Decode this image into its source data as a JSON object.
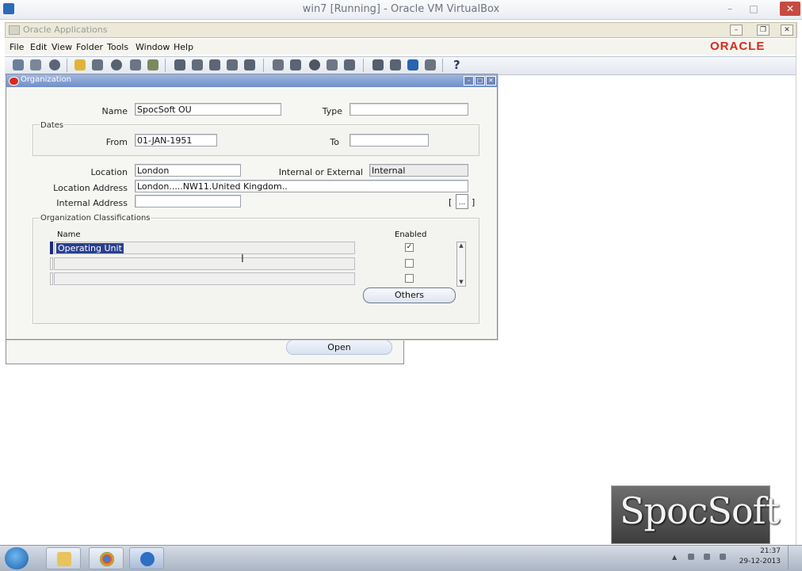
{
  "host": {
    "title": "win7 [Running] - Oracle VM VirtualBox",
    "buttons": {
      "minimize": "–",
      "maximize": "□",
      "close": "✕"
    }
  },
  "app": {
    "title": "Oracle Applications",
    "mdi_buttons": {
      "minimize": "–",
      "restore": "❐",
      "close": "✕"
    },
    "menu": [
      "File",
      "Edit",
      "View",
      "Folder",
      "Tools",
      "Window",
      "Help"
    ],
    "brand": "ORACLE",
    "toolbar_icons": [
      "new-icon",
      "find-icon",
      "navigator-icon",
      "save-icon",
      "next-step-icon",
      "print-icon",
      "close-form-icon",
      "cut-icon",
      "copy-icon",
      "paste-icon",
      "clear-record-icon",
      "delete-record-icon",
      "edit-field-icon",
      "zoom-icon",
      "translations-icon",
      "attachments-icon",
      "folder-tools-icon",
      "window-help-icon",
      "help-icon"
    ]
  },
  "org_window": {
    "title": "Organization",
    "name_label": "Name",
    "name_value": "SpocSoft OU",
    "type_label": "Type",
    "type_value": "",
    "dates_group": "Dates",
    "from_label": "From",
    "from_value": "01-JAN-1951",
    "to_label": "To",
    "to_value": "",
    "location_label": "Location",
    "location_value": "London",
    "int_ext_label": "Internal or External",
    "int_ext_value": "Internal",
    "location_address_label": "Location Address",
    "location_address_value": "London.....NW11.United Kingdom..",
    "internal_address_label": "Internal Address",
    "internal_address_value": "",
    "lov_bracket_left": "[",
    "lov_bracket_right": "]",
    "lov_button": "...",
    "classifications_group": "Organization Classifications",
    "col_name": "Name",
    "col_enabled": "Enabled",
    "rows": [
      {
        "name": "Operating Unit",
        "enabled": true
      },
      {
        "name": "",
        "enabled": false
      },
      {
        "name": "",
        "enabled": false
      }
    ],
    "others_button": "Others"
  },
  "bg_window": {
    "open_button": "Open"
  },
  "watermark": "SpocSoft",
  "taskbar": {
    "clock_time": "21:37",
    "clock_date": "29-12-2013",
    "apps": [
      "explorer-icon",
      "chrome-icon",
      "internet-explorer-icon"
    ]
  }
}
